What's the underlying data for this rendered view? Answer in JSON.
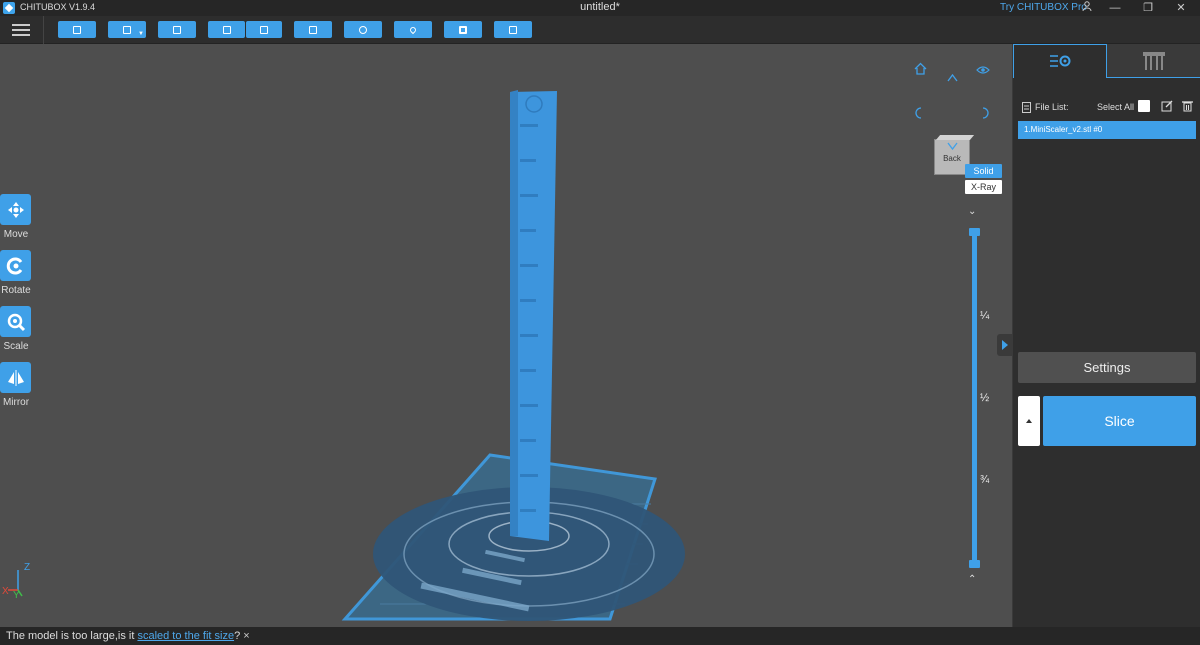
{
  "app": {
    "name": "CHITUBOX V1.9.4",
    "document_title": "untitled*",
    "try_pro_label": "Try CHITUBOX Pro"
  },
  "window_controls": {
    "account_icon": "user-icon",
    "minimize_glyph": "—",
    "restore_glyph": "❐",
    "close_glyph": "✕"
  },
  "toolbar": {
    "buttons": [
      {
        "icon": "open-file-icon"
      },
      {
        "icon": "save-icon"
      },
      {
        "icon": "screenshot-icon"
      },
      {
        "icon": "import-icon"
      },
      {
        "icon": "export-icon"
      },
      {
        "icon": "platform-icon"
      },
      {
        "icon": "arrange-icon"
      },
      {
        "icon": "drop-icon"
      },
      {
        "icon": "hollow-icon"
      },
      {
        "icon": "lock-icon"
      }
    ]
  },
  "left_tools": [
    {
      "label": "Move",
      "icon": "move-icon"
    },
    {
      "label": "Rotate",
      "icon": "rotate-icon"
    },
    {
      "label": "Scale",
      "icon": "scale-icon"
    },
    {
      "label": "Mirror",
      "icon": "mirror-icon"
    }
  ],
  "view_controls": {
    "cube_face": "Back",
    "render_modes": {
      "solid": "Solid",
      "xray": "X-Ray"
    },
    "layer_fractions": [
      "¼",
      "½",
      "¾"
    ],
    "chevron_down": "⌄",
    "chevron_up": "⌃"
  },
  "right_panel": {
    "file_list_label": "File List:",
    "select_all_label": "Select All",
    "files": [
      "1.MiniScaler_v2.stl #0"
    ],
    "settings_label": "Settings",
    "slice_label": "Slice"
  },
  "status": {
    "message_prefix": "The model is too large,is it ",
    "message_link": "scaled to the fit size",
    "message_suffix": "?",
    "close_glyph": "×"
  },
  "axis": {
    "x": "X",
    "y": "Y",
    "z": "Z"
  },
  "colors": {
    "accent": "#3fa0e8",
    "background": "#4e4e4e",
    "panel": "#2e2e2e",
    "titlebar": "#262626"
  }
}
